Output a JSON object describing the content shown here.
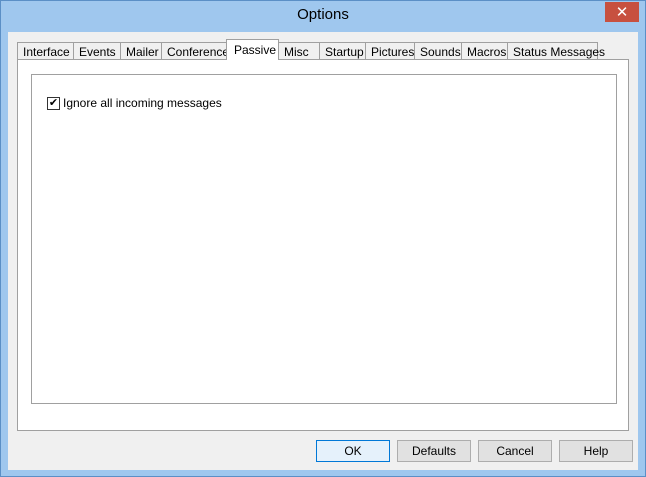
{
  "window": {
    "title": "Options",
    "close_glyph": "✕"
  },
  "tabs": [
    {
      "label": "Interface",
      "active": false
    },
    {
      "label": "Events",
      "active": false
    },
    {
      "label": "Mailer",
      "active": false
    },
    {
      "label": "Conference",
      "active": false
    },
    {
      "label": "Passive",
      "active": true
    },
    {
      "label": "Misc",
      "active": false
    },
    {
      "label": "Startup",
      "active": false
    },
    {
      "label": "Pictures",
      "active": false
    },
    {
      "label": "Sounds",
      "active": false
    },
    {
      "label": "Macros",
      "active": false
    },
    {
      "label": "Status Messages",
      "active": false
    }
  ],
  "passive": {
    "ignore_incoming": {
      "label": "Ignore all incoming messages",
      "checked": true,
      "check_glyph": "✔"
    }
  },
  "buttons": {
    "ok": "OK",
    "defaults": "Defaults",
    "cancel": "Cancel",
    "help": "Help"
  },
  "colors": {
    "title_bar": "#9fc7ee",
    "close_button": "#c7503f",
    "dialog_bg": "#f0f0f0"
  }
}
